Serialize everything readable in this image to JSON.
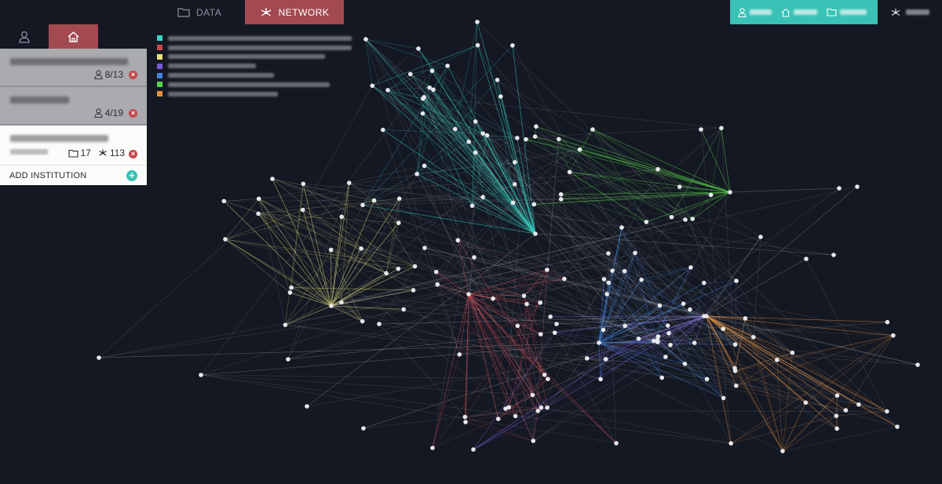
{
  "tabs": {
    "data": {
      "label": "DATA",
      "icon": "folder-icon"
    },
    "network": {
      "label": "NETWORK",
      "icon": "network-icon"
    }
  },
  "sidebar": {
    "cards": [
      {
        "members": "8/13"
      },
      {
        "members": "4/19"
      },
      {
        "folders": "17",
        "connections": "113"
      }
    ],
    "add_label": "ADD INSTITUTION"
  },
  "legend": {
    "colors": [
      "#35d4c4",
      "#c9474e",
      "#e6e17a",
      "#7b5cd6",
      "#3f82d8",
      "#5ad24a",
      "#e5903c"
    ]
  },
  "colors": {
    "background": "#141823",
    "accent_teal": "#39c2b5",
    "accent_red": "#a24a50"
  }
}
